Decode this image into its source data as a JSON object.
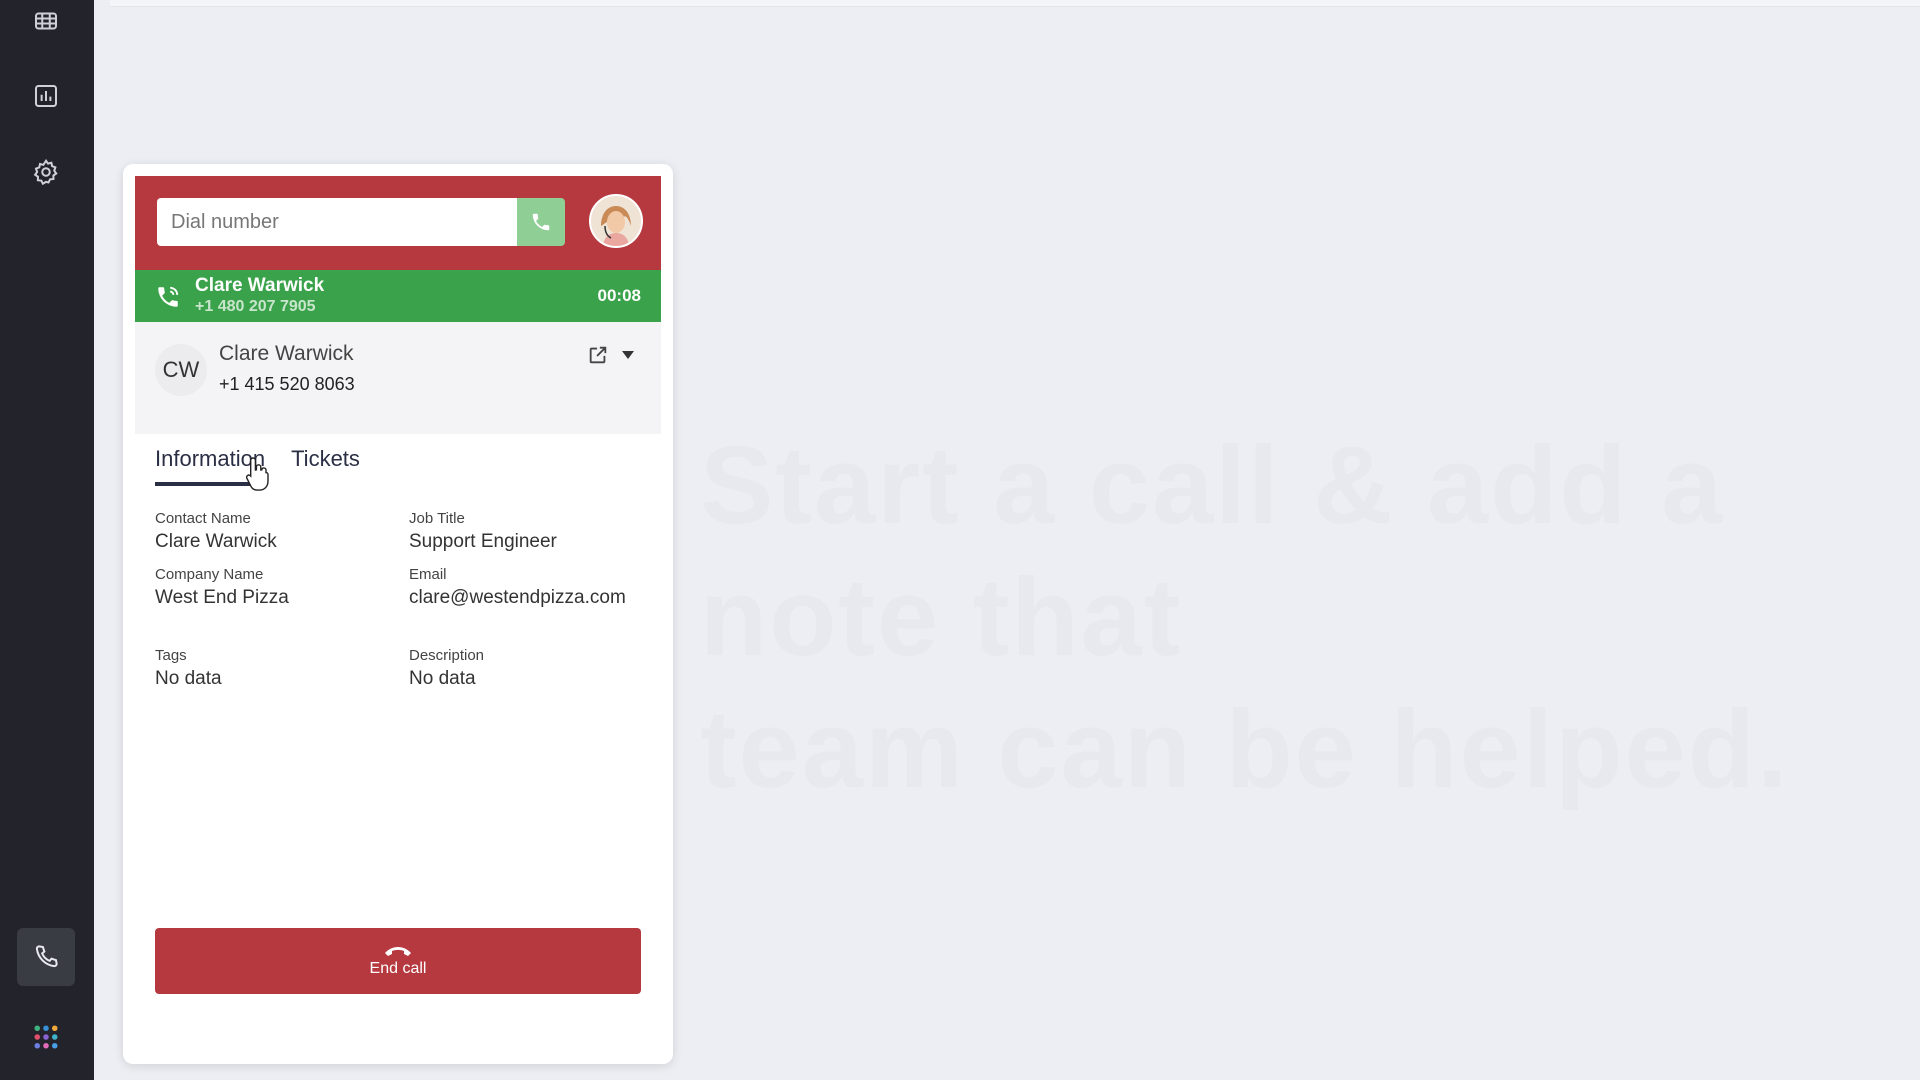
{
  "sidebar": {
    "items": [
      {
        "name": "dashboard-icon"
      },
      {
        "name": "reports-icon"
      },
      {
        "name": "settings-icon"
      }
    ],
    "phone_icon": "phone-icon",
    "apps_icon": "apps-grid-icon"
  },
  "background_text": {
    "line1": "Start a call & add a note that",
    "line2": "team can be helped."
  },
  "dialer": {
    "placeholder": "Dial number"
  },
  "active_call": {
    "name": "Clare Warwick",
    "number": "+1 480 207 7905",
    "timer": "00:08"
  },
  "contact": {
    "initials": "CW",
    "name": "Clare Warwick",
    "phone": "+1 415 520 8063"
  },
  "tabs": [
    {
      "label": "Information",
      "active": true
    },
    {
      "label": "Tickets",
      "active": false
    }
  ],
  "fields": {
    "contact_name": {
      "label": "Contact Name",
      "value": "Clare Warwick"
    },
    "job_title": {
      "label": "Job Title",
      "value": "Support Engineer"
    },
    "company_name": {
      "label": "Company Name",
      "value": "West End Pizza"
    },
    "email": {
      "label": "Email",
      "value": "clare@westendpizza.com"
    },
    "tags": {
      "label": "Tags",
      "value": "No data"
    },
    "description": {
      "label": "Description",
      "value": "No data"
    }
  },
  "end_call": {
    "label": "End call"
  },
  "colors": {
    "brand_red": "#b5393f",
    "call_green": "#3aa24a",
    "dial_green": "#8fce95",
    "sidebar": "#23242b"
  }
}
